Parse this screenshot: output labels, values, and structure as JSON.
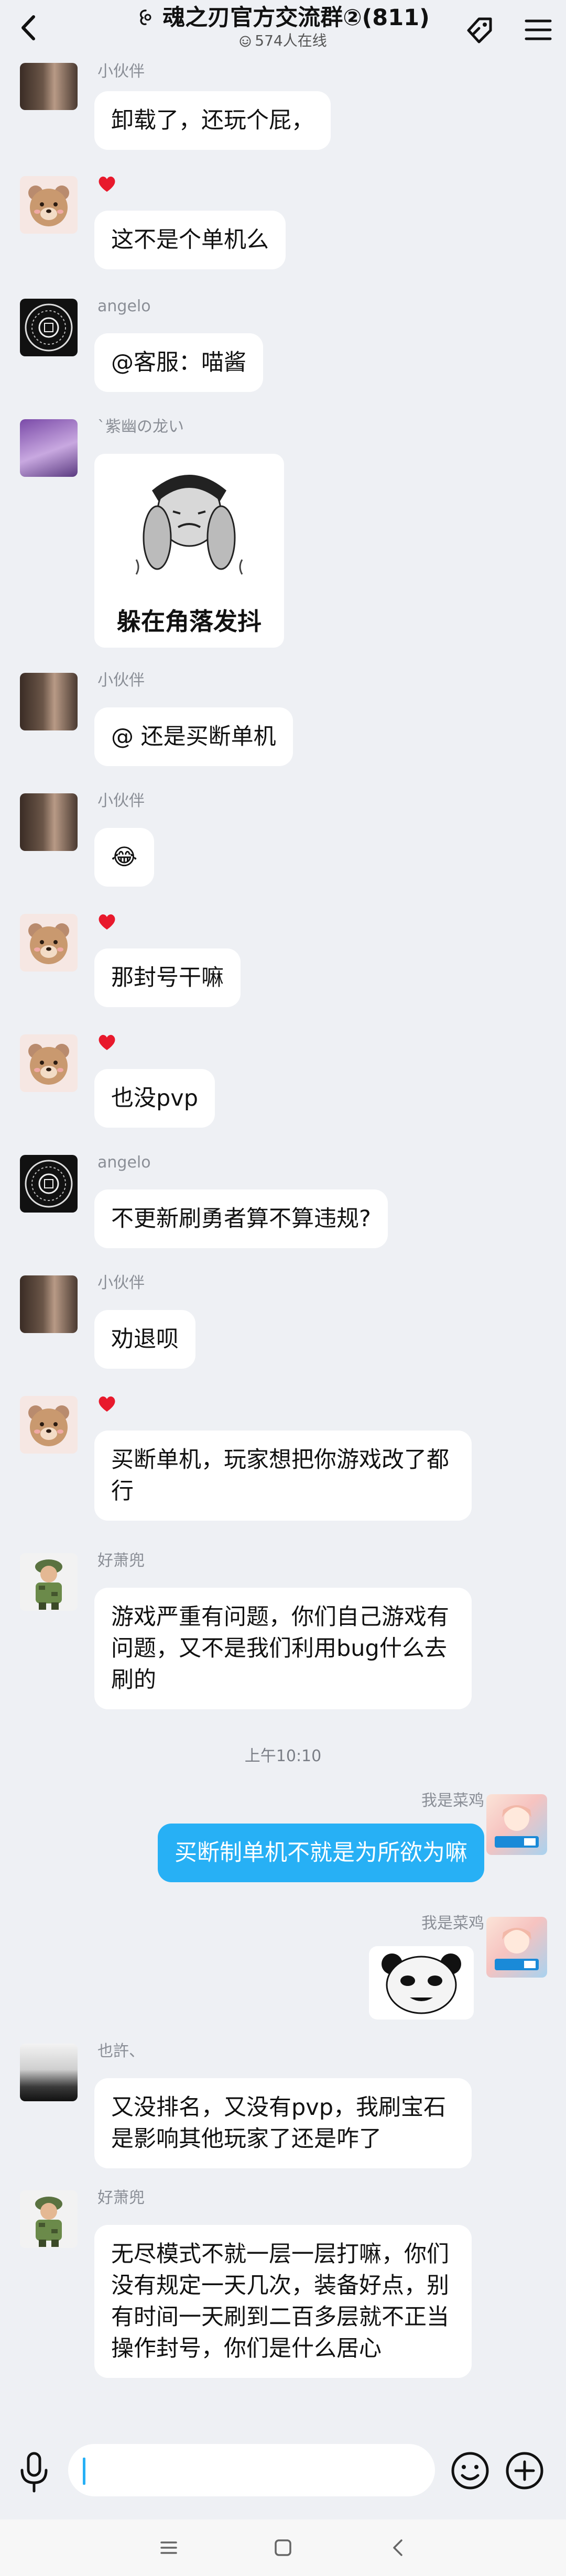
{
  "header": {
    "title": "魂之刃官方交流群②(811)",
    "online": "574人在线"
  },
  "messages": [
    {
      "sender": "小伙伴",
      "text": "卸载了，还玩个屁，"
    },
    {
      "sender": "",
      "text": "这不是个单机么"
    },
    {
      "sender": "angelo",
      "text": "@客服：喵酱"
    },
    {
      "sender": "`紫幽の龙い",
      "sticker_caption": "躲在角落发抖"
    },
    {
      "sender": "小伙伴",
      "text": "@ 还是买断单机"
    },
    {
      "sender": "小伙伴",
      "text": "😂"
    },
    {
      "sender": "",
      "text": "那封号干嘛"
    },
    {
      "sender": "",
      "text": "也没pvp"
    },
    {
      "sender": "angelo",
      "text": "不更新刷勇者算不算违规?"
    },
    {
      "sender": "小伙伴",
      "text": "劝退呗"
    },
    {
      "sender": "",
      "text": "买断单机，玩家想把你游戏改了都行"
    },
    {
      "sender": "好萧兜",
      "text": "游戏严重有问题，你们自己游戏有问题，又不是我们利用bug什么去刷的"
    },
    {
      "sender": "我是菜鸡",
      "text": "买断制单机不就是为所欲为嘛"
    },
    {
      "sender": "我是菜鸡",
      "text": ""
    },
    {
      "sender": "也許、",
      "text": "又没排名，又没有pvp，我刷宝石是影响其他玩家了还是咋了"
    },
    {
      "sender": "好萧兜",
      "text": "无尽模式不就一层一层打嘛，你们没有规定一天几次，装备好点，别有时间一天刷到二百多层就不正当操作封号，你们是什么居心"
    }
  ],
  "time_divider": "上午10:10",
  "colors": {
    "background": "#eef0f4",
    "self_bubble": "#27b0f5",
    "other_bubble": "#ffffff",
    "heart": "#e8192c"
  },
  "input": {
    "value": "",
    "placeholder": ""
  },
  "icons": [
    "back-arrow-icon",
    "group-icon",
    "online-icon",
    "tag-icon",
    "menu-icon",
    "heart-icon",
    "mic-icon",
    "emoji-icon",
    "plus-icon",
    "nav-menu-icon",
    "nav-home-icon",
    "nav-back-icon"
  ]
}
